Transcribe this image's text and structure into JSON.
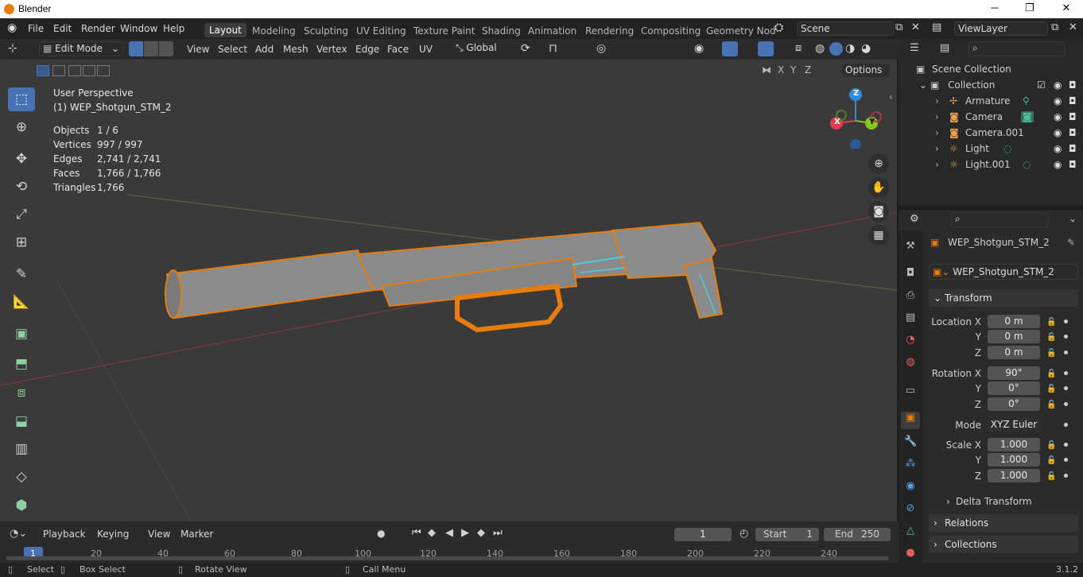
{
  "window": {
    "title": "Blender",
    "minimize": "─",
    "restore": "❐",
    "close": "✕"
  },
  "menu": {
    "items": [
      "File",
      "Edit",
      "Render",
      "Window",
      "Help"
    ],
    "workspaces": [
      "Layout",
      "Modeling",
      "Sculpting",
      "UV Editing",
      "Texture Paint",
      "Shading",
      "Animation",
      "Rendering",
      "Compositing",
      "Geometry Nod"
    ],
    "active_workspace": "Layout",
    "scene": "Scene",
    "view_layer": "ViewLayer"
  },
  "viewport_header": {
    "mode": "Edit Mode",
    "menus": [
      "View",
      "Select",
      "Add",
      "Mesh",
      "Vertex",
      "Edge",
      "Face",
      "UV"
    ],
    "orientation": "Global",
    "options": "Options",
    "axes": [
      "X",
      "Y",
      "Z"
    ]
  },
  "overlay": {
    "perspective": "User Perspective",
    "object": "(1) WEP_Shotgun_STM_2",
    "stats": [
      {
        "label": "Objects",
        "value": "1 / 6"
      },
      {
        "label": "Vertices",
        "value": "997 / 997"
      },
      {
        "label": "Edges",
        "value": "2,741 / 2,741"
      },
      {
        "label": "Faces",
        "value": "1,766 / 1,766"
      },
      {
        "label": "Triangles",
        "value": "1,766"
      }
    ]
  },
  "gizmo": {
    "x": "X",
    "y": "Y",
    "z": "Z",
    "colors": {
      "x": "#e83a4e",
      "y": "#84c81d",
      "z": "#2d8ce0"
    }
  },
  "outliner": {
    "root": "Scene Collection",
    "collection": "Collection",
    "items": [
      "Armature",
      "Camera",
      "Camera.001",
      "Light",
      "Light.001"
    ]
  },
  "properties": {
    "object_name": "WEP_Shotgun_STM_2",
    "data_name": "WEP_Shotgun_STM_2",
    "transform": {
      "title": "Transform",
      "location_label": "Location X",
      "location": [
        "0 m",
        "0 m",
        "0 m"
      ],
      "rotation_label": "Rotation X",
      "rotation": [
        "90°",
        "0°",
        "0°"
      ],
      "mode_label": "Mode",
      "mode": "XYZ Euler",
      "scale_label": "Scale X",
      "scale": [
        "1.000",
        "1.000",
        "1.000"
      ],
      "y": "Y",
      "z": "Z"
    },
    "delta": "Delta Transform",
    "relations": "Relations",
    "collections": "Collections"
  },
  "timeline": {
    "menus": [
      "Playback",
      "Keying",
      "View",
      "Marker"
    ],
    "frame": "1",
    "start_label": "Start",
    "start": "1",
    "end_label": "End",
    "end": "250",
    "ticks": [
      "1",
      "20",
      "40",
      "60",
      "80",
      "100",
      "120",
      "140",
      "160",
      "180",
      "200",
      "220",
      "240"
    ]
  },
  "status": {
    "select": "Select",
    "box_select": "Box Select",
    "rotate": "Rotate View",
    "call_menu": "Call Menu",
    "version": "3.1.2"
  },
  "colors": {
    "accent": "#4772b3",
    "edit_orange": "#e87d0d",
    "selected_edge": "#4cd0e0",
    "viewport_bg": "#3a3a3a"
  }
}
